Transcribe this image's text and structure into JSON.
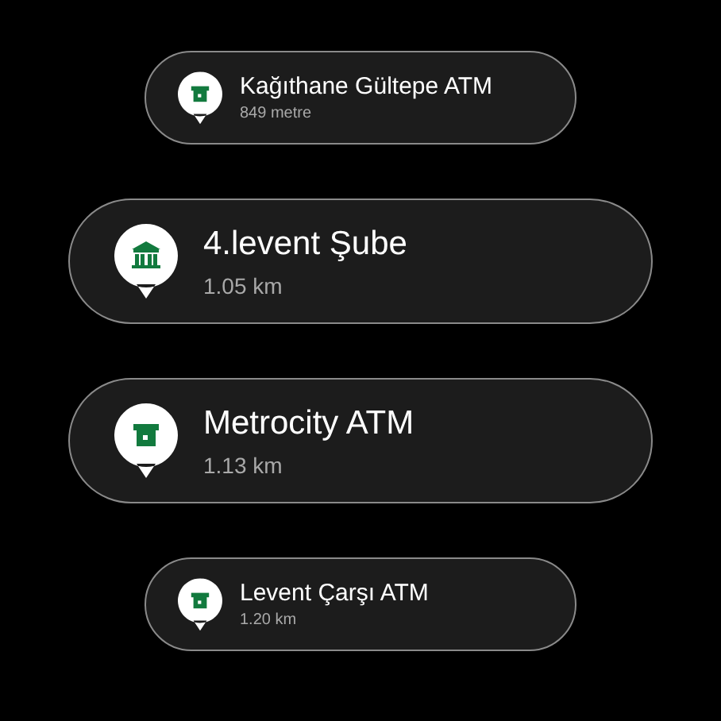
{
  "locations": [
    {
      "name": "Kağıthane Gültepe ATM",
      "distance": "849 metre",
      "kind": "atm",
      "focused": false
    },
    {
      "name": "4.levent Şube",
      "distance": "1.05 km",
      "kind": "branch",
      "focused": true
    },
    {
      "name": "Metrocity ATM",
      "distance": "1.13 km",
      "kind": "atm",
      "focused": true
    },
    {
      "name": "Levent Çarşı ATM",
      "distance": "1.20 km",
      "kind": "atm",
      "focused": false
    }
  ]
}
